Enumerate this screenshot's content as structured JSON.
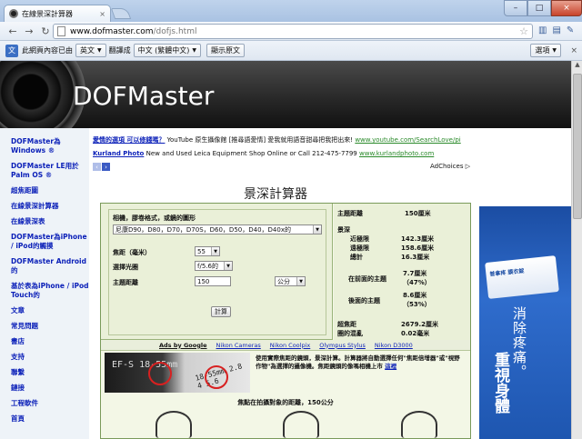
{
  "browser": {
    "tab_title": "在線景深計算器",
    "tab_close": "×",
    "url_host": "www.dofmaster.com",
    "url_path": "/dofjs.html",
    "win_min": "–",
    "win_max": "□",
    "win_close": "×"
  },
  "translate_bar": {
    "prefix": "此網頁內容已由",
    "source_lang": "英文",
    "middle": "翻譯成",
    "target_lang": "中文 (繁體中文)",
    "show_original": "顯示原文",
    "options": "選項"
  },
  "site": {
    "brand": "DOFMaster"
  },
  "leftnav": [
    "DOFMaster為Windows ®",
    "DOFMaster LE用於Palm OS ®",
    "超焦距圖",
    "在線景深計算器",
    "在線景深表",
    "DOFMaster為iPhone / iPod的觸摸",
    "DOFMaster Android的",
    "基於表為iPhone / iPod Touch的",
    "文章",
    "常見問題",
    "書店",
    "支持",
    "聯繫",
    "鏈接",
    "工程軟件",
    "首頁"
  ],
  "ads": {
    "line1_title": "愛情的選項 可以修錢嗎？",
    "line1_text": "YouTube 原生攝像館 [推尋語愛情] 愛我就用語音甜尋把我把出來!",
    "line1_url": "www.youtube.com/SearchLove/pi",
    "line2_title": "Kurland Photo",
    "line2_text": "New and Used Leica Equipment Shop Online or Call 212-475-7799",
    "line2_url": "www.kurlandphoto.com",
    "adchoices": "AdChoices ▷",
    "prev": "‹",
    "next": "›"
  },
  "calculator": {
    "title": "景深計算器",
    "camera_label": "相機，膠卷格式，或鏡的圖形",
    "camera_value": "尼康D90，D80，D70，D70S，D60，D50，D40，D40x的",
    "focal_label": "焦距（毫米）",
    "focal_value": "55",
    "aperture_label": "選擇光圈",
    "aperture_value": "f/5.6的",
    "distance_label": "主題距離",
    "distance_value": "150",
    "unit_value": "公分",
    "compute_button": "計算"
  },
  "results": {
    "subject_distance_label": "主題距離",
    "subject_distance_value": "150厘米",
    "dof_label": "景深",
    "near_label": "近極限",
    "near_value": "142.3厘米",
    "far_label": "遠極限",
    "far_value": "158.6厘米",
    "total_label": "總計",
    "total_value": "16.3厘米",
    "in_front_label": "在前面的主題",
    "in_front_value": "7.7厘米",
    "in_front_pct": "（47%）",
    "behind_label": "後面的主題",
    "behind_value": "8.6厘米",
    "behind_pct": "（53%）",
    "hyperfocal_label": "超焦距",
    "hyperfocal_value": "2679.2厘米",
    "coc_label": "圈的混亂",
    "coc_value": "0.02毫米"
  },
  "ad_links": {
    "ads_by": "Ads by Google",
    "link1": "Nikon Cameras",
    "link2": "Nikon Coolpix",
    "link3": "Olympus Stylus",
    "link4": "Nikon D3000"
  },
  "photo": {
    "lens_text1": "EF-S 18-55mm",
    "lens_text2": "18-55mm 2.8 4 5.6",
    "caption": "使用實際焦距的鏡頭，景深計算。計算器將自動選擇任何\"焦距倍增器\"或\"視野作物\"為選擇的攝像機。焦距鏡頭的像嗎相機上市",
    "caption_link": "這裡",
    "focus_title": "焦點在拍攝對象的距離，150公分"
  },
  "side_ad": {
    "pack_text": "普拿疼 膜衣錠",
    "vtext": "消除疼痛。",
    "vtext2": "重視身體"
  }
}
